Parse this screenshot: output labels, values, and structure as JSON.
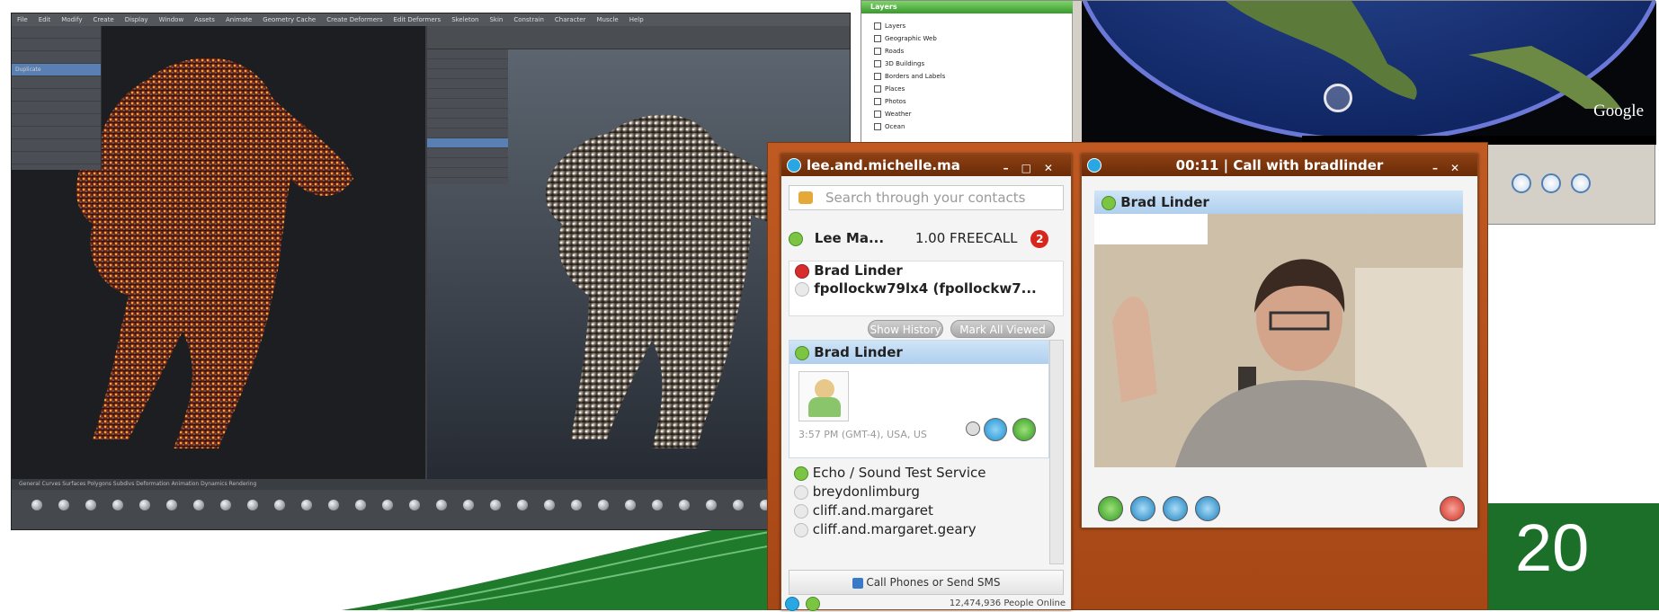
{
  "maya": {
    "menu": [
      "File",
      "Edit",
      "Modify",
      "Create",
      "Display",
      "Window",
      "Assets",
      "Animate",
      "Geometry Cache",
      "Create Deformers",
      "Edit Deformers",
      "Skeleton",
      "Skin",
      "Constrain",
      "Character",
      "Muscle",
      "Help"
    ],
    "panel_items": [
      "",
      "",
      "",
      "Duplicate",
      "",
      "",
      "",
      "",
      "",
      "",
      ""
    ],
    "shelf_tabs": "General   Curves   Surfaces   Polygons   Subdivs   Deformation   Animation   Dynamics   Rendering"
  },
  "earth": {
    "layers_title": "Layers",
    "layers": [
      "Layers",
      "Geographic Web",
      "Roads",
      "3D Buildings",
      "Borders and Labels",
      "Places",
      "Photos",
      "Weather",
      "Ocean"
    ],
    "logo": "Google"
  },
  "skype_contacts": {
    "title": "lee.and.michelle.ma",
    "search_placeholder": "Search through your contacts",
    "profile_name": "Lee Ma...",
    "credit": "1.00 FREECALL",
    "badge": "2",
    "recent": [
      "Brad Linder",
      "fpollockw79lx4 (fpollockw7..."
    ],
    "show_history": "Show History",
    "mark_all_viewed": "Mark All Viewed",
    "card_name": "Brad Linder",
    "card_location": "3:57 PM (GMT-4), USA, US",
    "contacts": [
      "Echo / Sound Test Service",
      "breydonlimburg",
      "cliff.and.margaret",
      "cliff.and.margaret.geary"
    ],
    "sms_button": "Call Phones or Send SMS",
    "online_count": "12,474,936 People Online"
  },
  "skype_call": {
    "title": "00:11 | Call with bradlinder",
    "contact": "Brad Linder"
  },
  "banner_number": "20",
  "colors": {
    "skype_orange": "#b9511b",
    "skype_blue": "#28a7e2",
    "green": "#7bc543",
    "red": "#d8261c",
    "banner_green": "#1f7a2c"
  }
}
